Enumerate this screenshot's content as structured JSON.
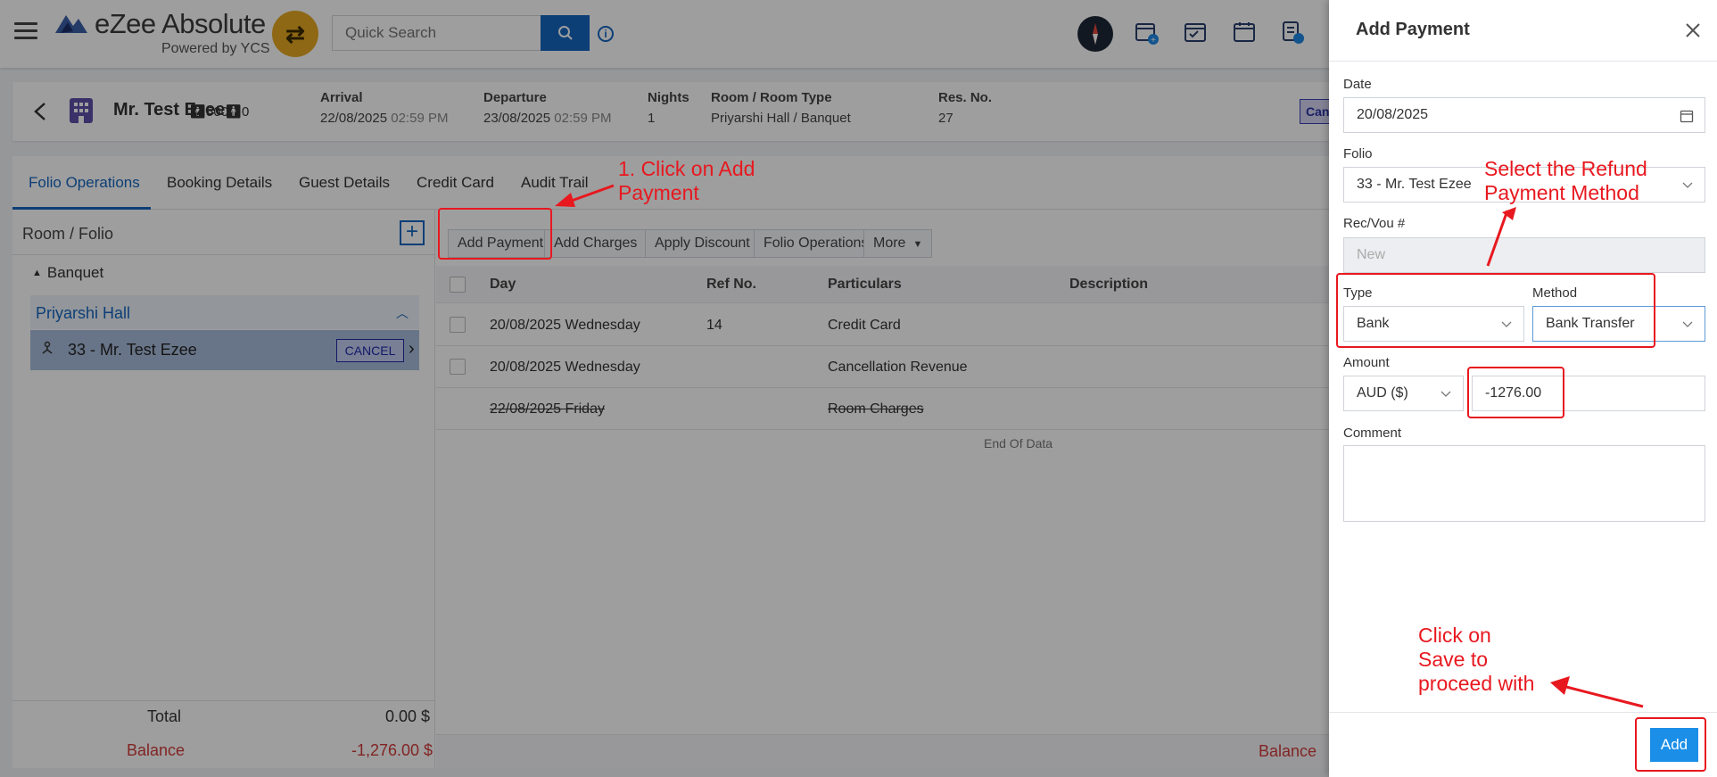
{
  "app": {
    "brand": "eZee Absolute",
    "powered_by": "Powered by YCS"
  },
  "topbar": {
    "search_placeholder": "Quick Search"
  },
  "guest": {
    "name": "Mr. Test Ezee",
    "adults": "500",
    "children": "0",
    "arrival_label": "Arrival",
    "arrival_date": "22/08/2025",
    "arrival_time": "02:59 PM",
    "departure_label": "Departure",
    "departure_date": "23/08/2025",
    "departure_time": "02:59 PM",
    "nights_label": "Nights",
    "nights": "1",
    "room_type_label": "Room / Room Type",
    "room_type": "Priyarshi Hall / Banquet",
    "res_label": "Res. No.",
    "res_no": "27",
    "status_tag": "Can"
  },
  "tabs": [
    "Folio Operations",
    "Booking Details",
    "Guest Details",
    "Credit Card",
    "Audit Trail"
  ],
  "left_panel": {
    "header": "Room / Folio",
    "group": "Banquet",
    "room": "Priyarshi Hall",
    "folio": "33 - Mr. Test Ezee",
    "folio_status": "CANCEL",
    "total_label": "Total",
    "total_value": "0.00 $",
    "balance_label": "Balance",
    "balance_value": "-1,276.00 $"
  },
  "actions": {
    "add_payment": "Add Payment",
    "add_charges": "Add Charges",
    "apply_discount": "Apply Discount",
    "folio_operations": "Folio Operations",
    "more": "More"
  },
  "table": {
    "columns": [
      "Day",
      "Ref No.",
      "Particulars",
      "Description"
    ],
    "rows": [
      {
        "day": "20/08/2025 Wednesday",
        "ref": "14",
        "particulars": "Credit Card",
        "voided": false
      },
      {
        "day": "20/08/2025 Wednesday",
        "ref": "",
        "particulars": "Cancellation Revenue",
        "voided": false
      },
      {
        "day": "22/08/2025 Friday",
        "ref": "",
        "particulars": "Room Charges",
        "voided": true
      }
    ],
    "end_text": "End Of Data",
    "footer_balance": "Balance"
  },
  "drawer": {
    "title": "Add Payment",
    "date_label": "Date",
    "date_value": "20/08/2025",
    "folio_label": "Folio",
    "folio_value": "33 - Mr. Test Ezee",
    "recvou_label": "Rec/Vou #",
    "recvou_placeholder": "New",
    "type_label": "Type",
    "type_value": "Bank",
    "method_label": "Method",
    "method_value": "Bank Transfer",
    "amount_label": "Amount",
    "currency_value": "AUD ($)",
    "amount_value": "-1276.00",
    "comment_label": "Comment",
    "add_button": "Add"
  },
  "annotations": {
    "step1_line1": "1. Click on Add",
    "step1_line2": "Payment",
    "refund_line1": "Select the Refund",
    "refund_line2": "Payment Method",
    "save_line1": "Click on",
    "save_line2": "Save to",
    "save_line3": "proceed with"
  },
  "colors": {
    "accent": "#1566c0",
    "brand_yellow": "#e5a823",
    "annotation_red": "#e8181f",
    "add_button": "#1b8fe8",
    "balance_red": "#d23b3b"
  }
}
